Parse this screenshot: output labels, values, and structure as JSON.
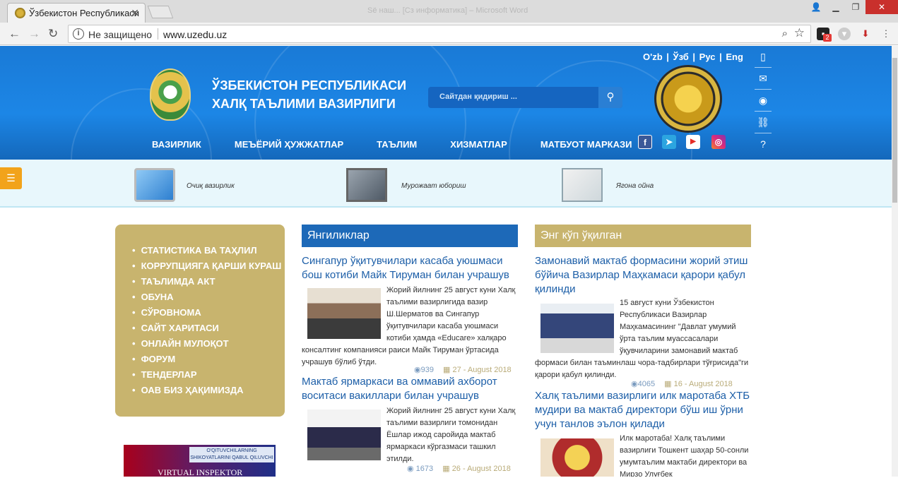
{
  "browser": {
    "tab_title": "Ўзбекистон Республикаси",
    "window_title": "Ѕё наш... [Сз информатика] – Microsoft Word",
    "security_text": "Не защищено",
    "url": "www.uzedu.uz",
    "extension_badge": "2"
  },
  "header": {
    "title_line1": "ЎЗБЕКИСТОН РЕСПУБЛИКАСИ",
    "title_line2": "ХАЛҚ ТАЪЛИМИ ВАЗИРЛИГИ",
    "search_placeholder": "Сайтдан қидириш ...",
    "languages": [
      "O'zb",
      "Ўзб",
      "Рус",
      "Eng"
    ],
    "menu": [
      "ВАЗИРЛИК",
      "МЕЪЁРИЙ ҲУЖЖАТЛАР",
      "ТАЪЛИМ",
      "ХИЗМАТЛАР",
      "МАТБУОТ МАРКАЗИ"
    ]
  },
  "quick_links": [
    "Очиқ вазирлик",
    "Мурожаат юбориш",
    "Ягона ойна"
  ],
  "left_menu": [
    "СТАТИСТИКА ВА ТАҲЛИЛ",
    "КОРРУПЦИЯГА ҚАРШИ КУРАШ",
    "ТАЪЛИМДА АКТ",
    "ОБУНА",
    "СЎРОВНОМА",
    "САЙТ ХАРИТАСИ",
    "ОНЛАЙН МУЛОҚОТ",
    "ФОРУМ",
    "ТЕНДЕРЛАР",
    "ОАВ БИЗ ҲАҚИМИЗДА"
  ],
  "banner": {
    "top_text": "O'QITUVCHILARNING SHIKOYATLARINI QABUL QILUVCHI",
    "bottom_text": "VIRTUAL INSPEKTOR"
  },
  "news": {
    "heading": "Янгиликлар",
    "items": [
      {
        "title": "Сингапур ўқитувчилари касаба уюшмаси бош котиби Майк Тируман билан учрашув",
        "body": "Жорий йилнинг 25 август куни Халқ таълими вазирлигида вазир Ш.Шерматов ва Сингапур ўқитувчилари касаба уюшмаси котиби ҳамда «Educare» халқаро консалтинг компанияси раиси Майк Тируман ўртасида учрашув бўлиб ўтди.",
        "views": "939",
        "date": "27 - August 2018"
      },
      {
        "title": "Мактаб ярмаркаси ва оммавий ахборот воситаси вакиллари билан учрашув",
        "body": "Жорий йилнинг 25 август куни Халқ таълими вазирлиги томонидан Ёшлар ижод саройида мактаб ярмаркаси кўргазмаси ташкил этилди.",
        "views": "1673",
        "date": "26 - August 2018"
      }
    ]
  },
  "popular": {
    "heading": "Энг кўп ўқилган",
    "items": [
      {
        "title": "Замонавий мактаб формасини жорий этиш бўйича Вазирлар Маҳкамаси қарори қабул қилинди",
        "body": "15 август куни Ўзбекистон Республикаси Вазирлар Маҳкамасининг \"Давлат умумий ўрта таълим муассасалари ўқувчиларини замонавий мактаб формаси билан таъминлаш чора-тадбирлари тўғрисида\"ги қарори қабул қилинди.",
        "views": "4065",
        "date": "16 - August 2018"
      },
      {
        "title": "Халқ таълими вазирлиги илк маротаба ХТБ мудири ва мактаб директори бўш иш ўрни учун танлов эълон қилади",
        "body": "Илк маротаба! Халқ таълими вазирлиги Тошкент шаҳар 50-сонли умумтаълим мактаби директори ва Мирзо Улуғбек"
      }
    ]
  }
}
